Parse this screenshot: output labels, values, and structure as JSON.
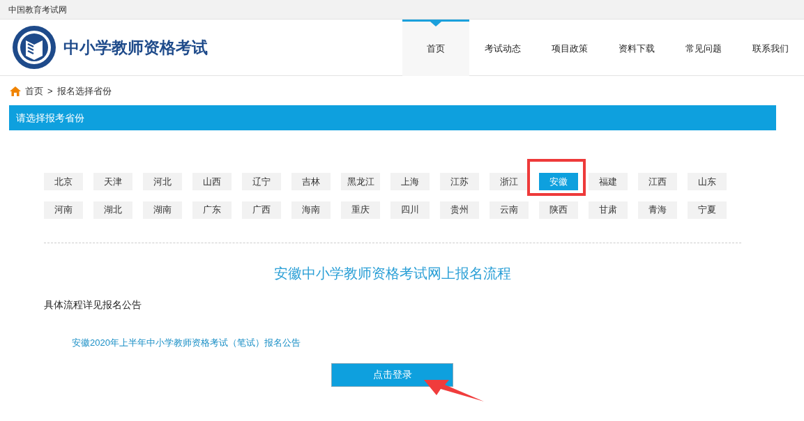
{
  "top_bar": {
    "site_name": "中国教育考试网"
  },
  "header": {
    "title": "中小学教师资格考试"
  },
  "nav": [
    {
      "label": "首页",
      "selected": true
    },
    {
      "label": "考试动态",
      "selected": false
    },
    {
      "label": "项目政策",
      "selected": false
    },
    {
      "label": "资料下载",
      "selected": false
    },
    {
      "label": "常见问题",
      "selected": false
    },
    {
      "label": "联系我们",
      "selected": false
    }
  ],
  "breadcrumb": {
    "home": "首页",
    "separator": ">",
    "current": "报名选择省份"
  },
  "section_title": "请选择报考省份",
  "provinces": [
    {
      "label": "北京",
      "selected": false,
      "highlighted": false
    },
    {
      "label": "天津",
      "selected": false,
      "highlighted": false
    },
    {
      "label": "河北",
      "selected": false,
      "highlighted": false
    },
    {
      "label": "山西",
      "selected": false,
      "highlighted": false
    },
    {
      "label": "辽宁",
      "selected": false,
      "highlighted": false
    },
    {
      "label": "吉林",
      "selected": false,
      "highlighted": false
    },
    {
      "label": "黑龙江",
      "selected": false,
      "highlighted": false
    },
    {
      "label": "上海",
      "selected": false,
      "highlighted": false
    },
    {
      "label": "江苏",
      "selected": false,
      "highlighted": false
    },
    {
      "label": "浙江",
      "selected": false,
      "highlighted": false
    },
    {
      "label": "安徽",
      "selected": true,
      "highlighted": true
    },
    {
      "label": "福建",
      "selected": false,
      "highlighted": false
    },
    {
      "label": "江西",
      "selected": false,
      "highlighted": false
    },
    {
      "label": "山东",
      "selected": false,
      "highlighted": false
    },
    {
      "label": "河南",
      "selected": false,
      "highlighted": false
    },
    {
      "label": "湖北",
      "selected": false,
      "highlighted": false
    },
    {
      "label": "湖南",
      "selected": false,
      "highlighted": false
    },
    {
      "label": "广东",
      "selected": false,
      "highlighted": false
    },
    {
      "label": "广西",
      "selected": false,
      "highlighted": false
    },
    {
      "label": "海南",
      "selected": false,
      "highlighted": false
    },
    {
      "label": "重庆",
      "selected": false,
      "highlighted": false
    },
    {
      "label": "四川",
      "selected": false,
      "highlighted": false
    },
    {
      "label": "贵州",
      "selected": false,
      "highlighted": false
    },
    {
      "label": "云南",
      "selected": false,
      "highlighted": false
    },
    {
      "label": "陕西",
      "selected": false,
      "highlighted": false
    },
    {
      "label": "甘肃",
      "selected": false,
      "highlighted": false
    },
    {
      "label": "青海",
      "selected": false,
      "highlighted": false
    },
    {
      "label": "宁夏",
      "selected": false,
      "highlighted": false
    }
  ],
  "process": {
    "title": "安徽中小学教师资格考试网上报名流程",
    "note": "具体流程详见报名公告",
    "link": "安徽2020年上半年中小学教师资格考试（笔试）报名公告"
  },
  "login_button": {
    "label": "点击登录",
    "arrow_pointer": true
  }
}
